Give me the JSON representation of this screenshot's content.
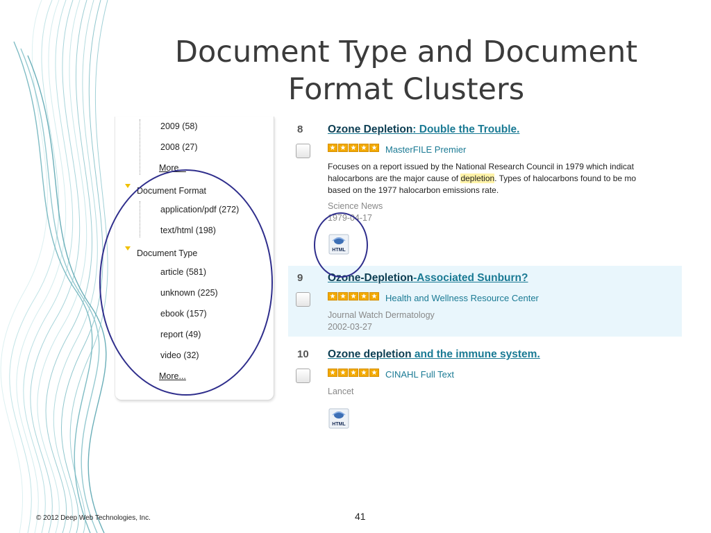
{
  "slide": {
    "title": "Document Type and Document Format Clusters",
    "footer": "© 2012 Deep Web Technologies, Inc.",
    "page_number": "41"
  },
  "facets": {
    "years": [
      "2009 (58)",
      "2008 (27)"
    ],
    "more_label": "More...",
    "format_group": "Document Format",
    "formats": [
      "application/pdf (272)",
      "text/html (198)"
    ],
    "type_group": "Document Type",
    "types": [
      "article (581)",
      "unknown (225)",
      "ebook (157)",
      "report (49)",
      "video (32)"
    ]
  },
  "results": [
    {
      "number": "8",
      "title_part1": "Ozone Depletion",
      "title_part2": ": Double the Trouble.",
      "source": "MasterFILE Premier",
      "desc_line1": "Focuses on a report issued by the National Research Council in 1979 which indicat",
      "desc_line2a": "halocarbons are the major cause of ",
      "desc_highlight": "depletion",
      "desc_line2b": ". Types of halocarbons found to be mo",
      "desc_line3": "based on the 1977 halocarbon emissions rate.",
      "publication": "Science News",
      "date": "1979-04-17",
      "icon_label": "HTML"
    },
    {
      "number": "9",
      "title_part1": "Ozone-Depletion",
      "title_part2": "-Associated Sunburn?",
      "source": "Health and Wellness Resource Center",
      "publication": "Journal Watch Dermatology",
      "date": "2002-03-27"
    },
    {
      "number": "10",
      "title_part1": "Ozone depletion",
      "title_part2": " and the immune system.",
      "source": "CINAHL Full Text",
      "publication": "Lancet",
      "icon_label": "HTML"
    }
  ],
  "colors": {
    "link": "#1a7a94",
    "title_dark": "#0c3d52",
    "highlight_row": "#e9f6fc",
    "annotation_ellipse": "#2f2e8c",
    "star": "#f2a900"
  }
}
